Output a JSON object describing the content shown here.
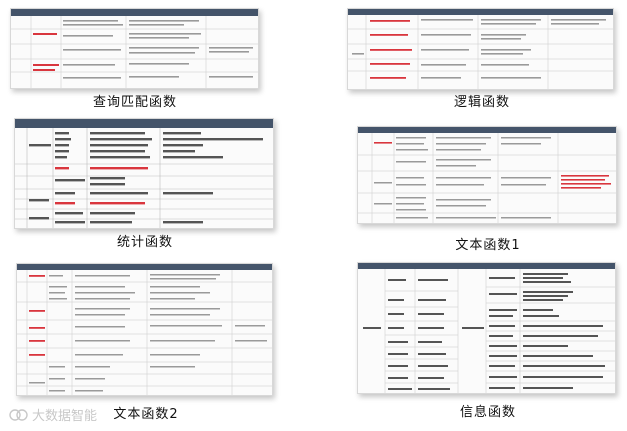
{
  "tiles": [
    {
      "caption": "查询匹配函数"
    },
    {
      "caption": "逻辑函数"
    },
    {
      "caption": "统计函数"
    },
    {
      "caption": "文本函数1"
    },
    {
      "caption": "文本函数2"
    },
    {
      "caption": "信息函数"
    }
  ],
  "watermark": {
    "text": "大数据智能"
  },
  "colors": {
    "header": "#44546a",
    "red_text": "#d9363e",
    "grid": "#c9c9c9"
  }
}
